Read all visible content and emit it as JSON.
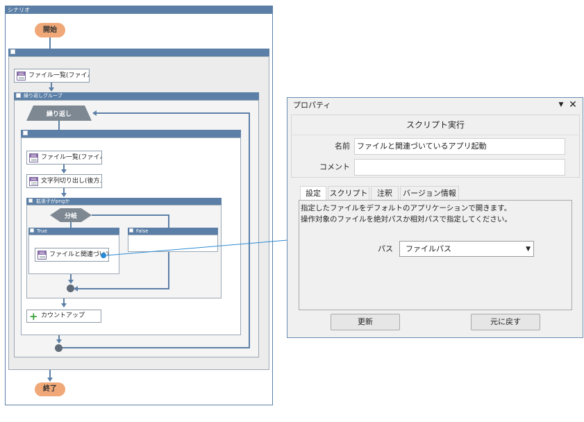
{
  "scenario": {
    "title": "シナリオ",
    "start": "開始",
    "end": "終了",
    "step_file_list": "ファイル一覧(ファイル数...",
    "loop_group_title": "繰り返しグループ",
    "loop_label": "繰り返し",
    "step_file_list_name": "ファイル一覧(ファイル名...",
    "step_substring": "文字列切り出し(後方...",
    "cond_group_title": "拡張子がpngか",
    "branch_label": "分岐",
    "true_label": "True",
    "false_label": "False",
    "step_open_file": "ファイルと関連づいてい...",
    "step_count_up": "カウントアップ"
  },
  "props": {
    "title": "プロパティ",
    "header": "スクリプト実行",
    "name_label": "名前",
    "name_value": "ファイルと関連づいているアプリ起動",
    "comment_label": "コメント",
    "comment_value": "",
    "tabs": [
      "設定",
      "スクリプト",
      "注釈",
      "バージョン情報"
    ],
    "description_line1": "指定したファイルをデフォルトのアプリケーションで開きます。",
    "description_line2": "操作対象のファイルを絶対パスか相対パスで指定してください。",
    "path_label": "パス",
    "path_value": "ファイルパス",
    "update_button": "更新",
    "revert_button": "元に戻す"
  },
  "colors": {
    "header_blue": "#5b7fa6",
    "pill_orange": "#f0a878",
    "link_line": "#2a8ad4"
  }
}
